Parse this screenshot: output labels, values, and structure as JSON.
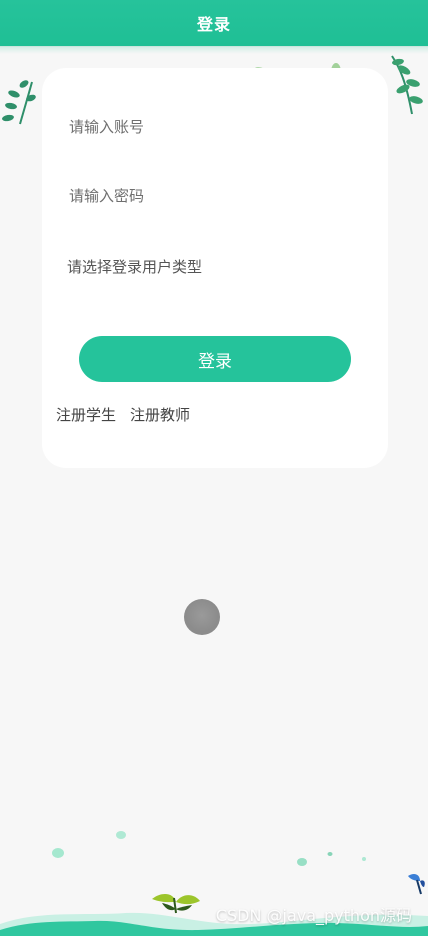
{
  "header": {
    "title": "登录"
  },
  "form": {
    "account_placeholder": "请输入账号",
    "password_placeholder": "请输入密码",
    "user_type_placeholder": "请选择登录用户类型",
    "login_button_label": "登录"
  },
  "links": {
    "register_student": "注册学生",
    "register_teacher": "注册教师"
  },
  "watermark": {
    "text": "CSDN @java_python源码"
  },
  "colors": {
    "accent": "#25c39b",
    "background": "#f7f7f7",
    "card": "#ffffff"
  },
  "icons": {
    "top_leaves": "leaf-icon",
    "loading": "loading-spinner-icon",
    "butterfly": "butterfly-icon"
  }
}
